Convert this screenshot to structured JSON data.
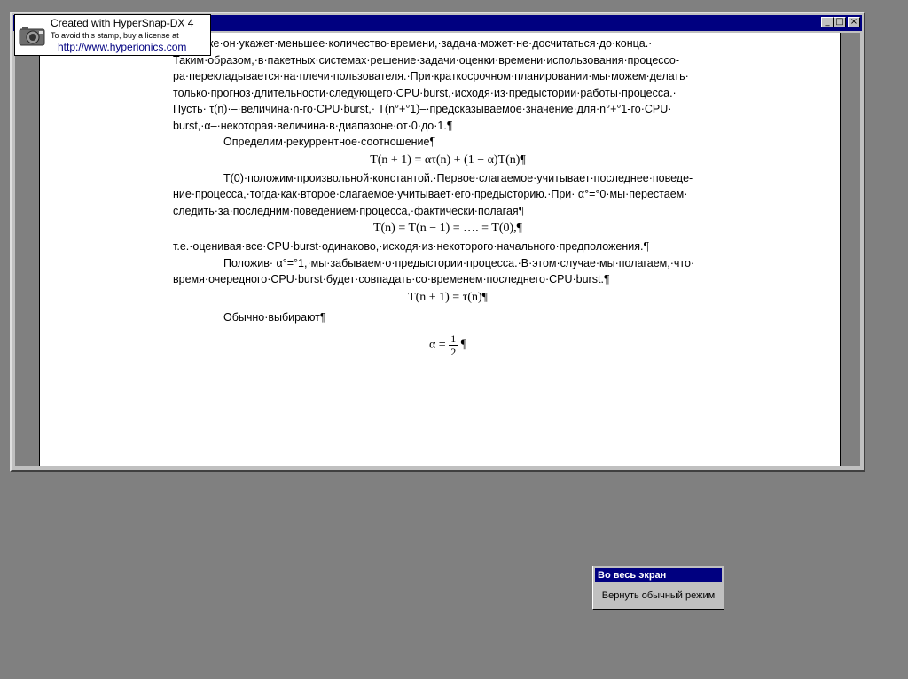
{
  "window": {
    "controls": {
      "minimize": "_",
      "maximize": "□",
      "close": "×"
    }
  },
  "stamp": {
    "line1": "Created with HyperSnap-DX 4",
    "line2": "To avoid this stamp, buy a license at",
    "url": "http://www.hyperionics.com"
  },
  "document": {
    "paragraphs": [
      "…сли·же·он·укажет·меньшее·количество·времени,·задача·может·не·досчитаться·до·конца.·",
      "Таким·образом,·в·пакетных·системах·решение·задачи·оценки·времени·использования·процессо-",
      "ра·перекладывается·на·плечи·пользователя.·При·краткосрочном·планировании·мы·можем·делать·",
      "только·прогноз·длительности·следующего·CPU·burst,·исходя·из·предыстории·работы·процесса.·",
      "Пусть· τ(n)·–·величина·n-го·CPU·burst,· T(n°+°1)–·предсказываемое·значение·для·n°+°1-го·CPU·",
      "burst,·α–·некоторая·величина·в·диапазоне·от·0·до·1.¶"
    ],
    "p2": "Определим·рекуррентное·соотношение¶",
    "eq1": "T(n + 1) = ατ(n) + (1 − α)T(n)¶",
    "p3a": "T(0)·положим·произвольной·константой.·Первое·слагаемое·учитывает·последнее·поведе-",
    "p3b": "ние·процесса,·тогда·как·второе·слагаемое·учитывает·его·предысторию.·При· α°=°0·мы·перестаем·",
    "p3c": "следить·за·последним·поведением·процесса,·фактически·полагая¶",
    "eq2": "T(n) = T(n − 1) = …. = T(0),¶",
    "p4": "т.е.·оценивая·все·CPU·burst·одинаково,·исходя·из·некоторого·начального·предположения.¶",
    "p5a": "Положив· α°=°1,·мы·забываем·о·предыстории·процесса.·В·этом·случае·мы·полагаем,·что·",
    "p5b": "время·очередного·CPU·burst·будет·совпадать·со·временем·последнего·CPU·burst.¶",
    "eq3": "T(n + 1) = τ(n)¶",
    "p6": "Обычно·выбирают¶",
    "eq4_lhs": "α =",
    "eq4_num": "1",
    "eq4_den": "2",
    "eq4_end": "¶"
  },
  "fullscreen": {
    "title": "Во весь экран",
    "button": "Вернуть обычный режим"
  }
}
